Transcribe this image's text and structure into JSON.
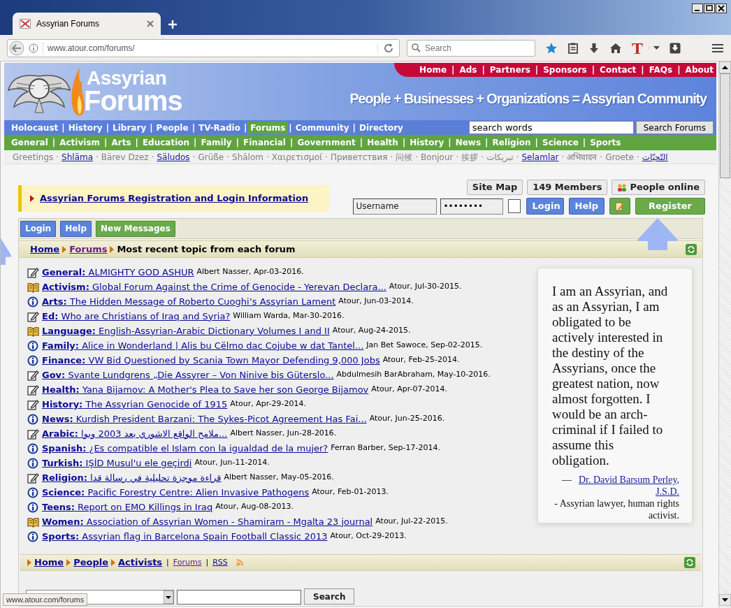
{
  "browser": {
    "tab_title": "Assyrian Forums",
    "url": "www.atour.com/forums/",
    "search_placeholder": "Search",
    "toolbar_glyph": "T"
  },
  "header": {
    "brand_top": "Assyrian",
    "brand_bottom": "Forums",
    "top_links": [
      "Home",
      "Ads",
      "Partners",
      "Sponsors",
      "Contact",
      "FAQs",
      "About"
    ],
    "separator": "|",
    "tagline": "People + Businesses + Organizations = Assyrian Community"
  },
  "main_nav": [
    {
      "label": "Holocaust",
      "selected": false
    },
    {
      "label": "History",
      "selected": false
    },
    {
      "label": "Library",
      "selected": false
    },
    {
      "label": "People",
      "selected": false
    },
    {
      "label": "TV-Radio",
      "selected": false
    },
    {
      "label": "Forums",
      "selected": true
    },
    {
      "label": "Community",
      "selected": false
    },
    {
      "label": "Directory",
      "selected": false
    }
  ],
  "site_search": {
    "value": "search words",
    "button": "Search Forums"
  },
  "category_nav": [
    "General",
    "Activism",
    "Arts",
    "Education",
    "Family",
    "Financial",
    "Government",
    "Health",
    "History",
    "News",
    "Religion",
    "Science",
    "Sports"
  ],
  "greetings": {
    "separator": "·",
    "items": [
      {
        "text": "Greetings",
        "link": false
      },
      {
        "text": "Shläma",
        "link": true
      },
      {
        "text": "Bärev Dzez",
        "link": false
      },
      {
        "text": "Säludos",
        "link": true
      },
      {
        "text": "Grüße",
        "link": false
      },
      {
        "text": "Shälom",
        "link": false
      },
      {
        "text": "Χαιρετισμοί",
        "link": false
      },
      {
        "text": "Приветствия",
        "link": false
      },
      {
        "text": "问候",
        "link": false
      },
      {
        "text": "Bonjour",
        "link": false
      },
      {
        "text": "挨拶",
        "link": false
      },
      {
        "text": "تبریکات",
        "link": false
      },
      {
        "text": "Selamlar",
        "link": true
      },
      {
        "text": "अभिवादन",
        "link": false
      },
      {
        "text": "Groete",
        "link": false
      },
      {
        "text": "التّحيّات",
        "link": true
      }
    ]
  },
  "notice": "Assyrian Forums Registration and Login Information",
  "account": {
    "buttons": [
      "Site Map",
      "149 Members",
      "People online"
    ],
    "username": "Username",
    "password": "••••••••",
    "remember": {
      "checked": false
    },
    "login": "Login",
    "help": "Help",
    "register": "Register"
  },
  "toolbar": [
    {
      "label": "Login",
      "kind": "standard"
    },
    {
      "label": "Help",
      "kind": "standard"
    },
    {
      "label": "New Messages",
      "kind": "highlight"
    }
  ],
  "breadcrumb": {
    "links": [
      {
        "label": "Home",
        "visited": false
      },
      {
        "label": "Forums",
        "visited": true
      }
    ],
    "current": "Most recent topic from each forum"
  },
  "topics": [
    {
      "kind": "note",
      "forum": "General:",
      "title": "ALMIGHTY GOD ASHUR",
      "meta": "Albert Nasser, Apr-03-2016."
    },
    {
      "kind": "book",
      "forum": "Activism:",
      "title": "Global Forum Against the Crime of Genocide - Yerevan Declara...",
      "meta": "Atour, Jul-30-2015."
    },
    {
      "kind": "info",
      "forum": "Arts:",
      "title": "The Hidden Message of Roberto Cuoghi’s Assyrian Lament",
      "meta": "Atour, Jun-03-2014."
    },
    {
      "kind": "note",
      "forum": "Ed:",
      "title": "Who are Christians of Iraq and Syria?",
      "meta": "William Warda, Mar-30-2016."
    },
    {
      "kind": "book",
      "forum": "Language:",
      "title": "English-Assyrian-Arabic Dictionary Volumes I and II",
      "meta": "Atour, Aug-24-2015."
    },
    {
      "kind": "info",
      "forum": "Family:",
      "title": "Alice in Wonderland | Alis bu Cëlmo dac Cojube w dat Tantel...",
      "meta": "Jan Bet Sawoce, Sep-02-2015."
    },
    {
      "kind": "info",
      "forum": "Finance:",
      "title": "VW Bid Questioned by Scania Town Mayor Defending 9,000 Jobs",
      "meta": "Atour, Feb-25-2014."
    },
    {
      "kind": "note",
      "forum": "Gov:",
      "title": "Svante Lundgrens „Die Assyrer – Von Ninive bis Güterslo...",
      "meta": "Abdulmesih BarAbraham, May-10-2016."
    },
    {
      "kind": "note",
      "forum": "Health:",
      "title": "Yana Bijamov: A Mother's Plea to Save her son George Bijamov",
      "meta": "Atour, Apr-07-2014."
    },
    {
      "kind": "note",
      "forum": "History:",
      "title": "The Assyrian Genocide of 1915",
      "meta": "Atour, Apr-29-2014."
    },
    {
      "kind": "info",
      "forum": "News:",
      "title": "Kurdish President Barzani: The Sykes-Picot Agreement Has Fai...",
      "meta": "Atour, Jun-25-2016."
    },
    {
      "kind": "note",
      "forum": "Arabic:",
      "title": "ملامح الواقع الاشوري بعد 2003 وبوا...",
      "meta": "Albert Nasser, Jun-28-2016."
    },
    {
      "kind": "info",
      "forum": "Spanish:",
      "title": "¿Es compatible el Islam con la igualdad de la mujer?",
      "meta": "Ferran Barber, Sep-17-2014."
    },
    {
      "kind": "info",
      "forum": "Turkish:",
      "title": "IŞİD Musul'u ele geçirdi",
      "meta": "Atour, Jun-11-2014."
    },
    {
      "kind": "note",
      "forum": "Religion:",
      "title": "قراءة موجزة تحليلية في رسالة قدا",
      "meta": "Albert Nasser, May-05-2016."
    },
    {
      "kind": "info",
      "forum": "Science:",
      "title": "Pacific Forestry Centre: Alien Invasive Pathogens",
      "meta": "Atour, Feb-01-2013."
    },
    {
      "kind": "info",
      "forum": "Teens:",
      "title": "Report on EMO Killings in Iraq",
      "meta": "Atour, Aug-08-2013."
    },
    {
      "kind": "book",
      "forum": "Women:",
      "title": "Association of Assyrian Women - Shamiram - Mgalta 23 journal",
      "meta": "Atour, Jul-22-2015."
    },
    {
      "kind": "info",
      "forum": "Sports:",
      "title": "Assyrian flag in Barcelona Spain Football Classic 2013",
      "meta": "Atour, Oct-29-2013."
    }
  ],
  "quote": {
    "text": "I am an Assyrian, and as an Assyrian, I am obligated to be actively interested in the destiny of the Assyrians, once the greatest nation, now almost forgotten. I would be an arch-criminal if I failed to assume this obligation.",
    "dash": "—",
    "author": "Dr. David Barsum Perley, J.S.D.",
    "role": "- Assyrian lawyer, human rights activist."
  },
  "footer_nav": {
    "links": [
      "Home",
      "People",
      "Activists"
    ],
    "small_links": [
      {
        "label": "Forums",
        "visited": true
      },
      {
        "label": "RSS",
        "visited": false
      }
    ]
  },
  "bottom_search": {
    "button": "Search"
  },
  "status_url": "www.atour.com/forums"
}
